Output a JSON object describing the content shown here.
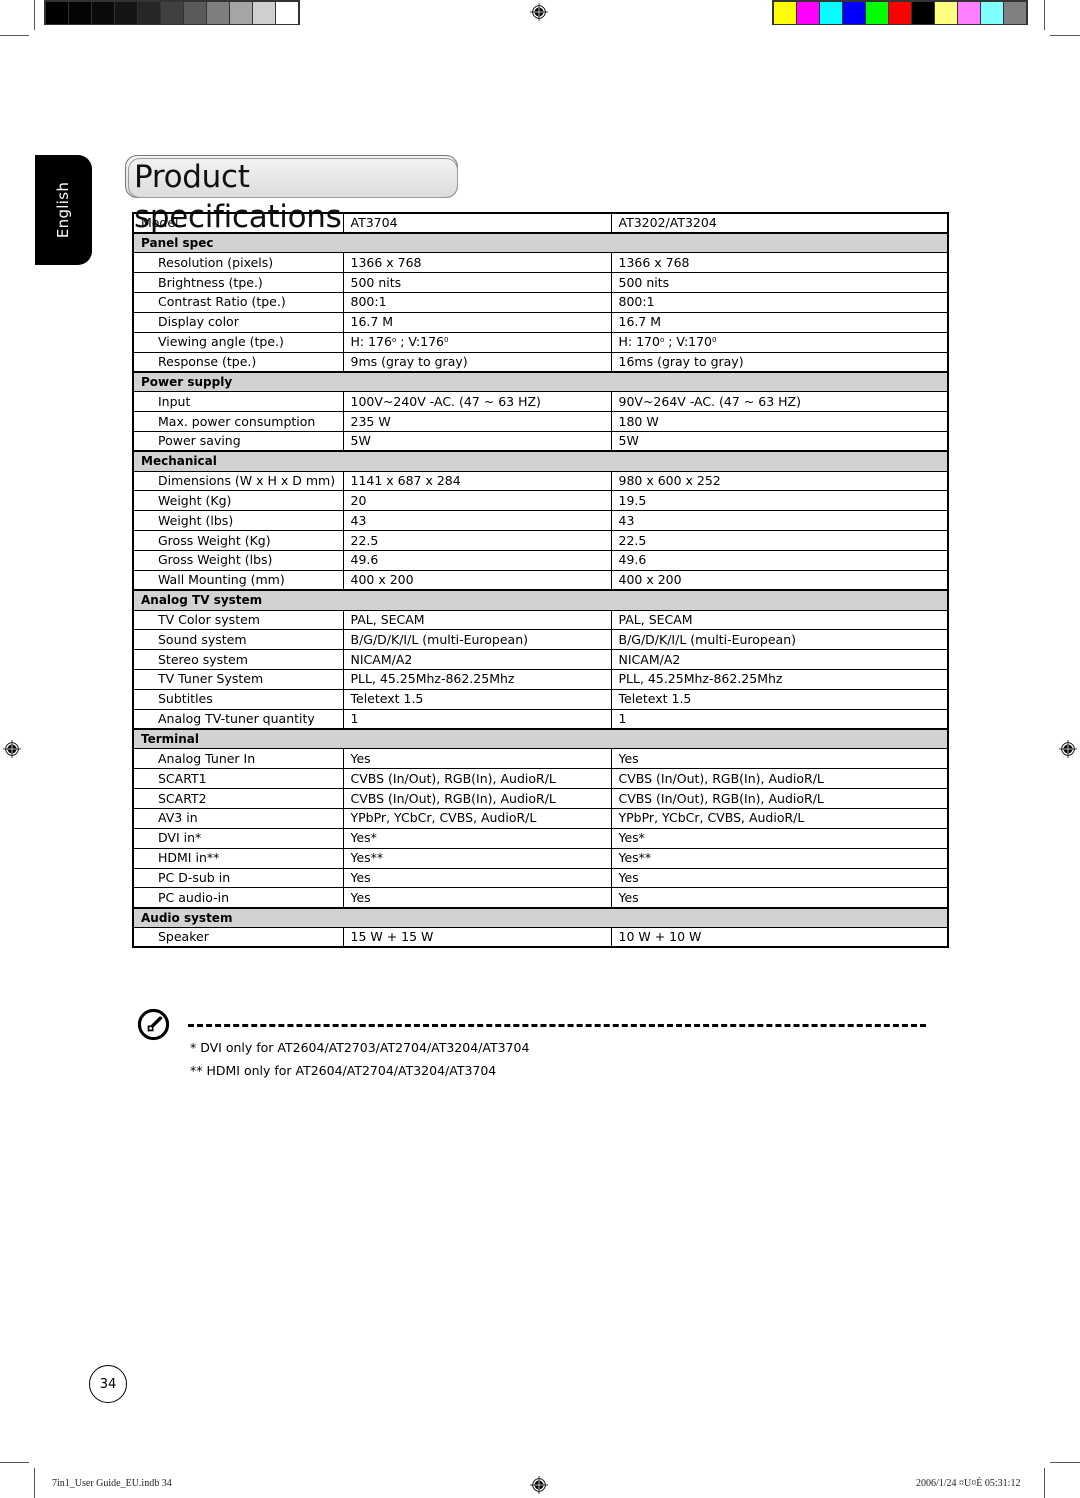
{
  "print_marks": {
    "gray_swatches": [
      "#000000",
      "#040404",
      "#0b0b0b",
      "#151515",
      "#262626",
      "#404040",
      "#5a5a5a",
      "#7f7f7f",
      "#a5a5a5",
      "#cfcfcf",
      "#ffffff"
    ],
    "color_swatches": [
      "#ffff00",
      "#ff00ff",
      "#00ffff",
      "#0000ff",
      "#00ff00",
      "#ff0000",
      "#000000",
      "#ffff80",
      "#ff80ff",
      "#80ffff",
      "#808080"
    ]
  },
  "language_tab": "English",
  "title": "Product specifications",
  "table": {
    "header": [
      "Model",
      "AT3704",
      "AT3202/AT3204"
    ],
    "sections": [
      {
        "name": "Panel spec",
        "rows": [
          [
            "Resolution (pixels)",
            "1366 x 768",
            "1366 x 768"
          ],
          [
            "Brightness (tpe.)",
            "500 nits",
            "500 nits"
          ],
          [
            "Contrast Ratio (tpe.)",
            "800:1",
            "800:1"
          ],
          [
            "Display color",
            "16.7 M",
            "16.7 M"
          ],
          [
            "Viewing angle (tpe.)",
            "H: 176° ; V:176°",
            "H: 170° ; V:170°"
          ],
          [
            "Response (tpe.)",
            "9ms (gray to gray)",
            "16ms (gray to gray)"
          ]
        ]
      },
      {
        "name": "Power supply",
        "rows": [
          [
            "Input",
            "100V~240V -AC. (47 ~ 63 HZ)",
            "90V~264V -AC. (47 ~ 63 HZ)"
          ],
          [
            "Max. power consumption",
            "235 W",
            "180 W"
          ],
          [
            "Power saving",
            "5W",
            "5W"
          ]
        ]
      },
      {
        "name": "Mechanical",
        "rows": [
          [
            "Dimensions (W x H x D mm)",
            "1141 x 687 x 284",
            "980 x 600 x 252"
          ],
          [
            "Weight (Kg)",
            "20",
            "19.5"
          ],
          [
            "Weight (lbs)",
            "43",
            "43"
          ],
          [
            "Gross Weight (Kg)",
            "22.5",
            "22.5"
          ],
          [
            "Gross Weight (lbs)",
            "49.6",
            "49.6"
          ],
          [
            "Wall Mounting (mm)",
            "400 x 200",
            "400 x 200"
          ]
        ]
      },
      {
        "name": "Analog TV system",
        "rows": [
          [
            "TV Color system",
            "PAL, SECAM",
            "PAL, SECAM"
          ],
          [
            "Sound system",
            "B/G/D/K/I/L (multi-European)",
            "B/G/D/K/I/L (multi-European)"
          ],
          [
            "Stereo system",
            "NICAM/A2",
            "NICAM/A2"
          ],
          [
            "TV Tuner System",
            "PLL, 45.25Mhz-862.25Mhz",
            "PLL, 45.25Mhz-862.25Mhz"
          ],
          [
            "Subtitles",
            "Teletext 1.5",
            "Teletext 1.5"
          ],
          [
            "Analog TV-tuner quantity",
            "1",
            "1"
          ]
        ]
      },
      {
        "name": "Terminal",
        "rows": [
          [
            "Analog Tuner In",
            "Yes",
            "Yes"
          ],
          [
            "SCART1",
            "CVBS (In/Out), RGB(In), AudioR/L",
            "CVBS (In/Out), RGB(In), AudioR/L"
          ],
          [
            "SCART2",
            "CVBS (In/Out), RGB(In), AudioR/L",
            "CVBS (In/Out), RGB(In), AudioR/L"
          ],
          [
            "AV3 in",
            "YPbPr, YCbCr, CVBS, AudioR/L",
            "YPbPr, YCbCr, CVBS, AudioR/L"
          ],
          [
            "DVI in*",
            "Yes*",
            "Yes*"
          ],
          [
            "HDMI in**",
            "Yes**",
            "Yes**"
          ],
          [
            "PC D-sub in",
            "Yes",
            "Yes"
          ],
          [
            "PC audio-in",
            "Yes",
            "Yes"
          ]
        ]
      },
      {
        "name": "Audio system",
        "rows": [
          [
            "Speaker",
            "15 W + 15 W",
            "10 W + 10 W"
          ]
        ]
      }
    ]
  },
  "notes": {
    "icon": "note-pen-icon",
    "lines": [
      "*  DVI only for AT2604/AT2703/AT2704/AT3204/AT3704",
      "** HDMI only for AT2604/AT2704/AT3204/AT3704"
    ]
  },
  "page_number": "34",
  "footer": {
    "file": "7in1_User Guide_EU.indb   34",
    "timestamp": "2006/1/24   ¤U¤È 05:31:12"
  }
}
